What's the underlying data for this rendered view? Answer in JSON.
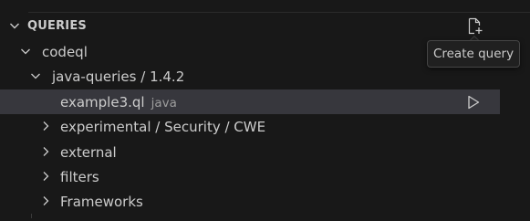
{
  "section": {
    "title": "QUERIES",
    "expanded_icon": "chevron-down-icon",
    "new_query_icon": "new-file-icon",
    "tooltip": "Create query"
  },
  "tree": {
    "root": {
      "label": "codeql",
      "expanded": true
    },
    "pack": {
      "label": "java-queries / 1.4.2",
      "expanded": true
    },
    "items": [
      {
        "label": "example3.ql",
        "description": "java",
        "selected": true,
        "action_icon": "run-icon"
      },
      {
        "label": "experimental / Security / CWE",
        "collapsed": true
      },
      {
        "label": "external",
        "collapsed": true
      },
      {
        "label": "filters",
        "collapsed": true
      },
      {
        "label": "Frameworks",
        "collapsed": true
      }
    ]
  },
  "colors": {
    "background": "#181818",
    "selection": "#37373d",
    "foreground": "#cccccc",
    "description": "#9d9d9d"
  }
}
